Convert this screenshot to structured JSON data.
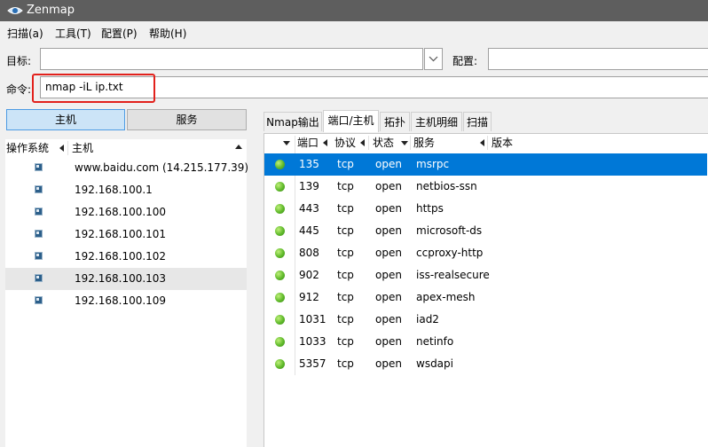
{
  "app": {
    "title": "Zenmap"
  },
  "menu": [
    "扫描(a)",
    "工具(T)",
    "配置(P)",
    "帮助(H)"
  ],
  "toolbar": {
    "target_label": "目标:",
    "target_value": "",
    "profile_label": "配置:",
    "profile_value": "",
    "command_label": "命令:",
    "command_value": "nmap -iL ip.txt"
  },
  "view_buttons": {
    "hosts": "主机",
    "services": "服务",
    "active": "hosts"
  },
  "host_list": {
    "columns": {
      "os": "操作系统",
      "host": "主机"
    },
    "selected_index": 5,
    "hosts": [
      "www.baidu.com (14.215.177.39)",
      "192.168.100.1",
      "192.168.100.100",
      "192.168.100.101",
      "192.168.100.102",
      "192.168.100.103",
      "192.168.100.109"
    ]
  },
  "tabs": [
    {
      "label": "Nmap输出",
      "active": false
    },
    {
      "label": "端口/主机",
      "active": true
    },
    {
      "label": "拓扑",
      "active": false
    },
    {
      "label": "主机明细",
      "active": false
    },
    {
      "label": "扫描",
      "active": false
    }
  ],
  "ports_table": {
    "columns": {
      "port": "端口",
      "protocol": "协议",
      "state": "状态",
      "service": "服务",
      "version": "版本"
    },
    "selected_index": 0,
    "state_color": "#5fb92a",
    "rows": [
      {
        "port": "135",
        "protocol": "tcp",
        "state": "open",
        "service": "msrpc",
        "version": ""
      },
      {
        "port": "139",
        "protocol": "tcp",
        "state": "open",
        "service": "netbios-ssn",
        "version": ""
      },
      {
        "port": "443",
        "protocol": "tcp",
        "state": "open",
        "service": "https",
        "version": ""
      },
      {
        "port": "445",
        "protocol": "tcp",
        "state": "open",
        "service": "microsoft-ds",
        "version": ""
      },
      {
        "port": "808",
        "protocol": "tcp",
        "state": "open",
        "service": "ccproxy-http",
        "version": ""
      },
      {
        "port": "902",
        "protocol": "tcp",
        "state": "open",
        "service": "iss-realsecure",
        "version": ""
      },
      {
        "port": "912",
        "protocol": "tcp",
        "state": "open",
        "service": "apex-mesh",
        "version": ""
      },
      {
        "port": "1031",
        "protocol": "tcp",
        "state": "open",
        "service": "iad2",
        "version": ""
      },
      {
        "port": "1033",
        "protocol": "tcp",
        "state": "open",
        "service": "netinfo",
        "version": ""
      },
      {
        "port": "5357",
        "protocol": "tcp",
        "state": "open",
        "service": "wsdapi",
        "version": ""
      }
    ]
  }
}
